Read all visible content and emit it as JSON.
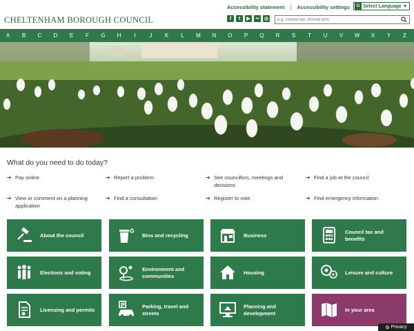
{
  "header": {
    "brand": "CHELTENHAM BOROUGH COUNCIL",
    "links": [
      "Accessibility statement",
      "Accessibility settings"
    ],
    "language": "Select Language",
    "search_placeholder": "e.g. council tax, missed bins",
    "social": [
      "facebook-icon",
      "twitter-icon",
      "youtube-icon",
      "flickr-icon",
      "instagram-icon"
    ]
  },
  "alphabet": [
    "A",
    "B",
    "C",
    "D",
    "E",
    "F",
    "G",
    "H",
    "I",
    "J",
    "K",
    "L",
    "M",
    "N",
    "O",
    "P",
    "Q",
    "R",
    "S",
    "T",
    "U",
    "V",
    "W",
    "X",
    "Y",
    "Z"
  ],
  "main": {
    "question": "What do you need to do today?",
    "tasks": [
      "Pay online",
      "Report a problem",
      "See councillors, meetings and decisions",
      "Find a job at the council",
      "View or comment on a planning application",
      "Find a consultation",
      "Register to vote",
      "Find emergency information"
    ],
    "tiles": [
      {
        "label": "About the council",
        "icon": "gavel-icon"
      },
      {
        "label": "Bins and recycling",
        "icon": "bin-icon"
      },
      {
        "label": "Business",
        "icon": "shop-icon"
      },
      {
        "label": "Council tax and benefits",
        "icon": "calculator-icon"
      },
      {
        "label": "Elections and voting",
        "icon": "people-icon"
      },
      {
        "label": "Environment and communities",
        "icon": "environment-icon"
      },
      {
        "label": "Housing",
        "icon": "house-icon"
      },
      {
        "label": "Leisure and culture",
        "icon": "football-icon"
      },
      {
        "label": "Licensing and permits",
        "icon": "licence-icon"
      },
      {
        "label": "Parking, travel and streets",
        "icon": "car-icon"
      },
      {
        "label": "Planning and development",
        "icon": "monitor-icon"
      },
      {
        "label": "In your area",
        "icon": "map-icon"
      }
    ]
  },
  "footer": {
    "privacy": "Privacy"
  },
  "colors": {
    "brand_green": "#2e7a4a",
    "accent_purple": "#8a3b6a"
  }
}
